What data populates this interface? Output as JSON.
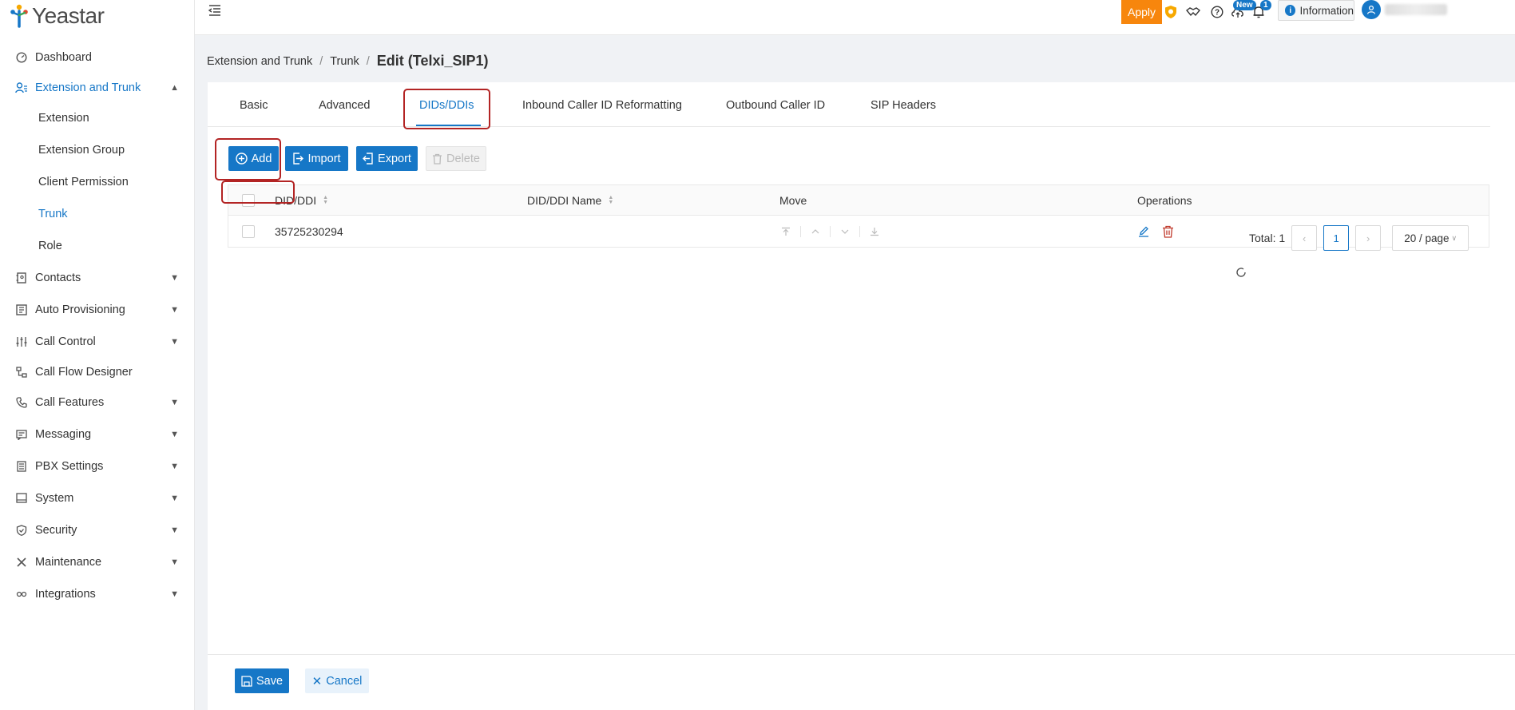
{
  "app": {
    "logo_text": "Yeastar"
  },
  "sidebar": {
    "items": [
      {
        "label": "Dashboard"
      },
      {
        "label": "Extension and Trunk"
      },
      {
        "label": "Extension"
      },
      {
        "label": "Extension Group"
      },
      {
        "label": "Client Permission"
      },
      {
        "label": "Trunk"
      },
      {
        "label": "Role"
      },
      {
        "label": "Contacts"
      },
      {
        "label": "Auto Provisioning"
      },
      {
        "label": "Call Control"
      },
      {
        "label": "Call Flow Designer"
      },
      {
        "label": "Call Features"
      },
      {
        "label": "Messaging"
      },
      {
        "label": "PBX Settings"
      },
      {
        "label": "System"
      },
      {
        "label": "Security"
      },
      {
        "label": "Maintenance"
      },
      {
        "label": "Integrations"
      }
    ]
  },
  "topbar": {
    "apply_label": "Apply",
    "new_badge": "New",
    "notif_count": "1",
    "info_label": "Information"
  },
  "breadcrumb": {
    "level1": "Extension and Trunk",
    "level2": "Trunk",
    "current": "Edit (Telxi_SIP1)"
  },
  "tabs": [
    {
      "label": "Basic"
    },
    {
      "label": "Advanced"
    },
    {
      "label": "DIDs/DDIs"
    },
    {
      "label": "Inbound Caller ID Reformatting"
    },
    {
      "label": "Outbound Caller ID"
    },
    {
      "label": "SIP Headers"
    }
  ],
  "active_tab": "DIDs/DDIs",
  "toolbar": {
    "add_label": "Add",
    "import_label": "Import",
    "export_label": "Export",
    "delete_label": "Delete"
  },
  "table": {
    "headers": {
      "did": "DID/DDI",
      "name": "DID/DDI Name",
      "move": "Move",
      "operations": "Operations"
    },
    "rows": [
      {
        "did": "35725230294",
        "name": ""
      }
    ]
  },
  "pagination": {
    "total_label": "Total: 1",
    "current_page": "1",
    "page_size": "20 / page"
  },
  "footer": {
    "save_label": "Save",
    "cancel_label": "Cancel"
  },
  "colors": {
    "primary": "#1677c7",
    "apply": "#f7860d",
    "highlight": "#b32424",
    "danger": "#c0392b"
  }
}
